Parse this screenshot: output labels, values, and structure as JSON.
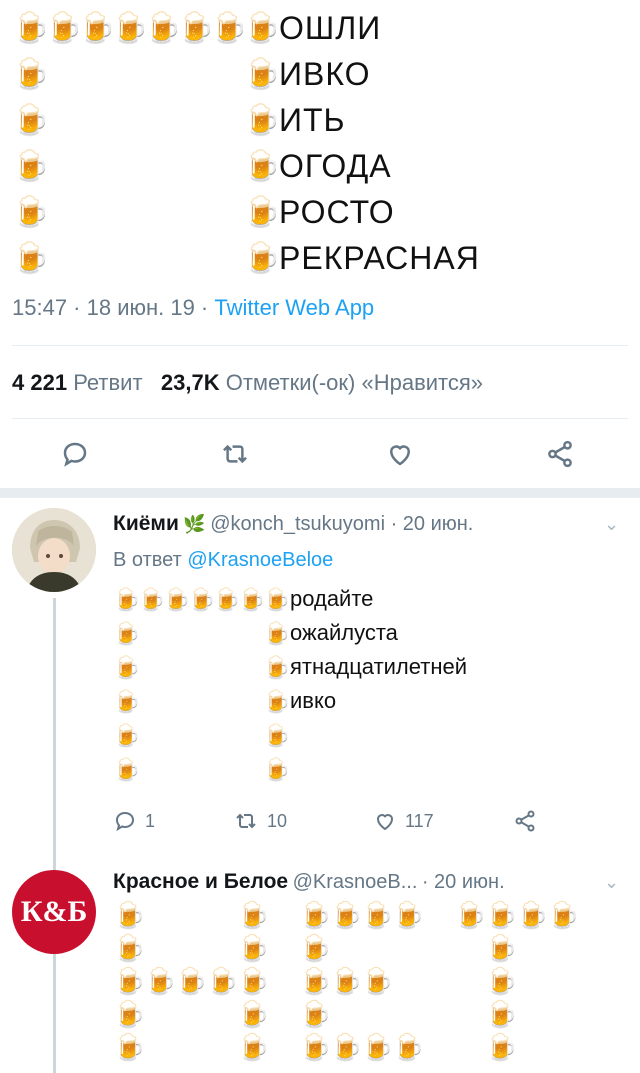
{
  "main_tweet": {
    "poem_words": [
      "ОШЛИ",
      "ИВКО",
      "ИТЬ",
      "ОГОДА",
      "РОСТО",
      "РЕКРАСНАЯ"
    ],
    "timestamp": "15:47 · 18 июн. 19 ·",
    "source": "Twitter Web App",
    "retweets_count": "4 221",
    "retweets_label": "Ретвит",
    "likes_count": "23,7K",
    "likes_label": "Отметки(-ок) «Нравится»"
  },
  "reply": {
    "display_name": "Киёми",
    "handle": "@konch_tsukuyomi · 20 июн.",
    "reply_prefix": "В ответ",
    "reply_to": "@KrasnoeBeloe",
    "poem_words": [
      "родайте",
      "ожайлуста",
      "ятнадцатилетней",
      "ивко"
    ],
    "reply_count": "1",
    "retweet_count": "10",
    "like_count": "117"
  },
  "reply2": {
    "avatar_text": "К&Б",
    "display_name": "Красное и Белое",
    "handle": "@KrasnoeB...",
    "time": "· 20 июн."
  },
  "colors": {
    "link": "#1da1f2",
    "muted": "#657786",
    "beer": "#e0a317",
    "brand_red": "#c8102e"
  },
  "icons": [
    "beer-mug-icon",
    "reply-icon",
    "retweet-icon",
    "heart-icon",
    "share-icon",
    "chevron-down-icon",
    "leaf-icon"
  ]
}
